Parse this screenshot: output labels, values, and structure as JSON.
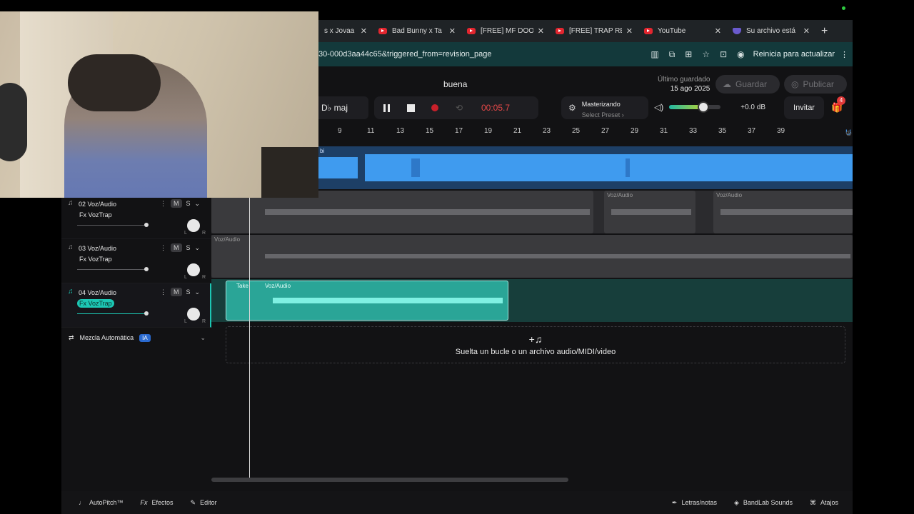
{
  "browser": {
    "tabs": [
      {
        "title": "s x Jovaa",
        "icon": "youtube-icon"
      },
      {
        "title": "Bad Bunny x Ta",
        "icon": "youtube-icon"
      },
      {
        "title": "[FREE] MF DOO",
        "icon": "youtube-icon"
      },
      {
        "title": "[FREE] TRAP RE",
        "icon": "youtube-icon"
      },
      {
        "title": "YouTube",
        "icon": "youtube-icon"
      },
      {
        "title": "Su archivo está",
        "icon": "shield-icon"
      }
    ],
    "url": "30-000d3aa44c65&triggered_from=revision_page",
    "update_button": "Reinicia para actualizar"
  },
  "app": {
    "project_name": "buena",
    "last_saved_label": "Último guardado",
    "last_saved_date": "15 ago 2025",
    "save_button": "Guardar",
    "publish_button": "Publicar",
    "key": "D♭ maj",
    "time": "00:05.7",
    "mastering_title": "Masterizando",
    "mastering_preset": "Select Preset ›",
    "volume_level": 0.67,
    "volume_db": "+0.0 dB",
    "invite_button": "Invitar",
    "gift_badge": "4",
    "ruler_marks": [
      "9",
      "11",
      "13",
      "15",
      "17",
      "19",
      "21",
      "23",
      "25",
      "27",
      "29",
      "31",
      "33",
      "35",
      "37",
      "39"
    ],
    "tracks": [
      {
        "number": "02",
        "name": "Voz/Audio",
        "fx": "Fx VozTrap",
        "volume": 0.8
      },
      {
        "number": "03",
        "name": "Voz/Audio",
        "fx": "Fx VozTrap",
        "volume": 0.8
      },
      {
        "number": "04",
        "name": "Voz/Audio",
        "fx": "Fx VozTrap",
        "volume": 0.8,
        "selected": true
      }
    ],
    "track_header_first": "02 Voz/Audio",
    "mute_label": "M",
    "solo_label": "S",
    "pan_left": "L",
    "pan_right": "R",
    "clip_label": "Voz/Audio",
    "take_label": "Take",
    "beat_clip_label": "bi",
    "automix_label": "Mezcla Automática",
    "automix_badge": "IA",
    "dropzone_text": "Suelta un bucle o un archivo audio/MIDI/video",
    "footer": {
      "autopitch": "AutoPitch™",
      "effects": "Efectos",
      "editor": "Editor",
      "lyrics": "Letras/notas",
      "sounds": "BandLab Sounds",
      "shortcuts": "Atajos"
    }
  },
  "colors": {
    "accent": "#1cc7b3",
    "beat_wave": "#3f9bef",
    "record": "#c8202a",
    "time": "#e54848"
  }
}
